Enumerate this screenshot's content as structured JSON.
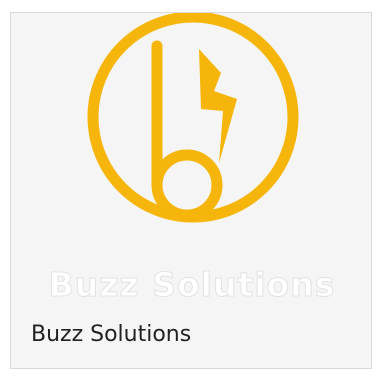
{
  "card": {
    "logo_wordmark": "Buzz Solutions",
    "caption": "Buzz Solutions",
    "logo_icon": "b-lightning-bolt-icon",
    "accent_color": "#f5b50a"
  }
}
